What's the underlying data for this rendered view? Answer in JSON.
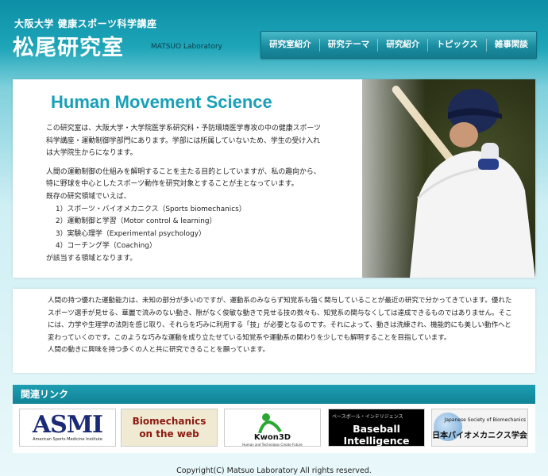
{
  "header": {
    "university": "大阪大学 健康スポーツ科学講座",
    "title": "松尾研究室",
    "subtitle": "MATSUO Laboratory"
  },
  "nav": [
    "研究室紹介",
    "研究テーマ",
    "研究紹介",
    "トピックス",
    "雑事閑談"
  ],
  "hero": {
    "heading": "Human Movement Science",
    "para1": "この研究室は、大阪大学・大学院医学系研究科・予防環境医学専攻の中の健康スポーツ科学講座・運動制御学部門にあります。学部には所属していないため、学生の受け入れは大学院生からになります。",
    "para2_lines": [
      "人間の運動制御の仕組みを解明することを主たる目的としていますが、私の趣向から、特に野球を中心としたスポーツ動作を研究対象とすることが主となっています。",
      "既存の研究領域でいえば、"
    ],
    "fields": [
      "1）スポーツ・バイオメカニクス（Sports biomechanics）",
      "2）運動制御と学習（Motor control & learning）",
      "3）実験心理学（Experimental psychology）",
      "4）コーチング学（Coaching）"
    ],
    "closing": "が該当する領域となります。"
  },
  "intro": {
    "line1": "人間の持つ優れた運動能力は、未知の部分が多いのですが、運動系のみならず知覚系も強く関与していることが最近の研究で分かってきています。優れたスポーツ選手が見せる、華麗で流みのない動き、隙がなく俊敏な動きで見せる技の数々も、知覚系の関与なくしては達成できるものではありません。そこには、力学や生理学の法則を感じ取り、それらを巧みに利用する「技」が必要となるのです。それによって、動きは洗練され、機能的にも美しい動作へと変わっていくのです。このような巧みな運動を成り立たせている知覚系や運動系の関わりを少しでも解明することを目指しています。",
    "line2": "人間の動きに興味を持つ多くの人と共に研究できることを願っています。"
  },
  "links": {
    "heading": "関連リンク",
    "asmi": {
      "big": "ASMI",
      "small": "American Sports Medicine Institute"
    },
    "biomech": {
      "line1": "Biomechanics",
      "line2": "on the web"
    },
    "kwon": {
      "name": "Kwon3D",
      "tag": "Human and Technology Create Future"
    },
    "bbi": {
      "small": "ベースボール・インテリジェンス",
      "big": "Baseball Intelligence"
    },
    "jsb": {
      "en": "Japanese Society of Biomechanics",
      "jp": "日本バイオメカニクス学会"
    }
  },
  "footer": "Copyright(C) Matsuo Laboratory All rights reserved."
}
